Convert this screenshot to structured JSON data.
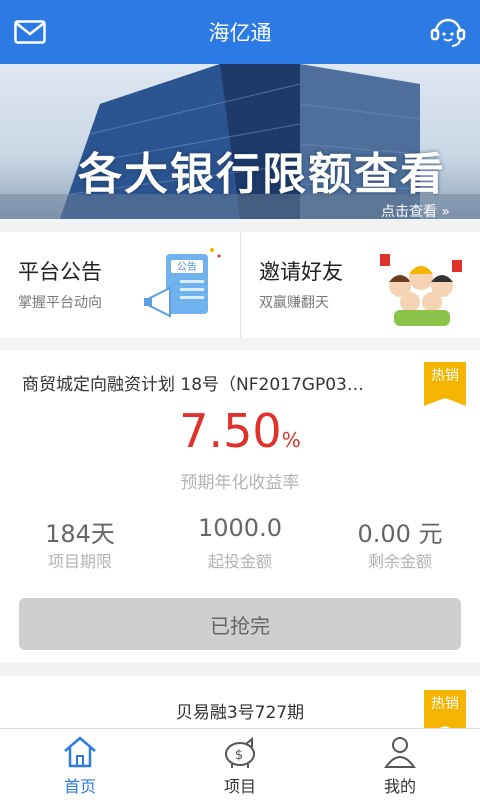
{
  "header": {
    "title": "海亿通",
    "left_icon": "mail-icon",
    "right_icon": "customer-service-icon"
  },
  "banner": {
    "headline": "各大银行限额查看",
    "more_link": "点击查看 »"
  },
  "quick_cards": [
    {
      "title": "平台公告",
      "subtitle": "掌握平台动向",
      "illustration": "announcement-board-icon",
      "illustration_text": "公告"
    },
    {
      "title": "邀请好友",
      "subtitle": "双赢赚翻天",
      "illustration": "friends-group-icon"
    }
  ],
  "products": [
    {
      "name": "商贸城定向融资计划 18号（NF2017GP03…",
      "badge": "热销",
      "rate": "7.50",
      "rate_unit": "%",
      "rate_label": "预期年化收益率",
      "stats": [
        {
          "value": "184天",
          "label": "项目期限"
        },
        {
          "value": "1000.0",
          "label": "起投金额"
        },
        {
          "value": "0.00 元",
          "label": "剩余金额"
        }
      ],
      "button_label": "已抢完"
    },
    {
      "name": "贝易融3号727期",
      "badge": "热销"
    }
  ],
  "tabs": [
    {
      "label": "首页",
      "icon": "home-icon",
      "active": true
    },
    {
      "label": "项目",
      "icon": "piggy-bank-icon",
      "active": false
    },
    {
      "label": "我的",
      "icon": "user-icon",
      "active": false
    }
  ],
  "colors": {
    "primary": "#2c7be5",
    "rate": "#e0322c",
    "badge": "#f5b400"
  }
}
